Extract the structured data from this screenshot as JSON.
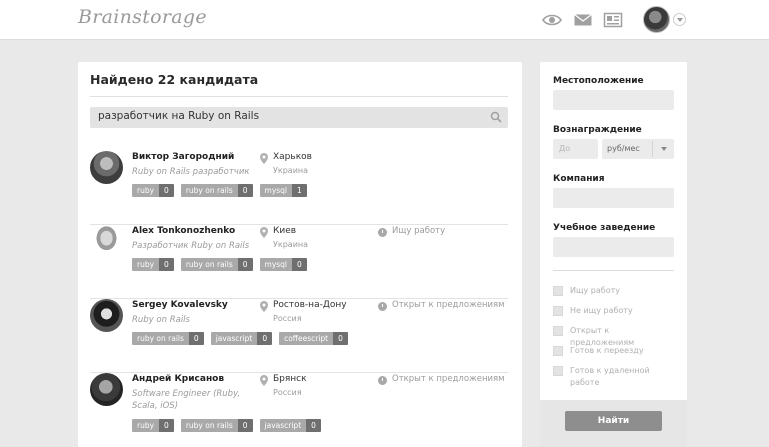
{
  "header": {
    "logo_text": "Brainstorage",
    "icons": [
      "eye-icon",
      "mail-icon",
      "newspaper-icon"
    ],
    "avatar": "user-avatar"
  },
  "results": {
    "title": "Найдено 22 кандидата",
    "search_value": "разработчик на Ruby on Rails",
    "candidates": [
      {
        "name": "Виктор Загородний",
        "position": "Ruby on Rails разработчик",
        "city": "Харьков",
        "country": "Украина",
        "status": "",
        "tags": [
          {
            "name": "ruby",
            "count": "0"
          },
          {
            "name": "ruby on rails",
            "count": "0"
          },
          {
            "name": "mysql",
            "count": "1"
          }
        ]
      },
      {
        "name": "Alex Tonkonozhenko",
        "position": "Разработчик Ruby on Rails",
        "city": "Киев",
        "country": "Украина",
        "status": "Ищу работу",
        "tags": [
          {
            "name": "ruby",
            "count": "0"
          },
          {
            "name": "ruby on rails",
            "count": "0"
          },
          {
            "name": "mysql",
            "count": "0"
          }
        ]
      },
      {
        "name": "Sergey Kovalevsky",
        "position": "Ruby on Rails",
        "city": "Ростов-на-Дону",
        "country": "Россия",
        "status": "Открыт к предложениям",
        "tags": [
          {
            "name": "ruby on rails",
            "count": "0"
          },
          {
            "name": "javascript",
            "count": "0"
          },
          {
            "name": "coffeescript",
            "count": "0"
          }
        ]
      },
      {
        "name": "Андрей Крисанов",
        "position": "Software Engineer (Ruby, Scala, iOS)",
        "city": "Брянск",
        "country": "Россия",
        "status": "Открыт к предложениям",
        "tags": [
          {
            "name": "ruby",
            "count": "0"
          },
          {
            "name": "ruby on rails",
            "count": "0"
          },
          {
            "name": "javascript",
            "count": "0"
          }
        ]
      }
    ]
  },
  "filters": {
    "location_label": "Местоположение",
    "salary_label": "Вознаграждение",
    "salary_placeholder": "До",
    "salary_unit": "руб/мес",
    "company_label": "Компания",
    "school_label": "Учебное заведение",
    "checkboxes": [
      "Ищу работу",
      "Не ищу работу",
      "Открыт к предложениям",
      "Готов к переезду",
      "Готов к удаленной работе"
    ],
    "submit_label": "Найти"
  }
}
